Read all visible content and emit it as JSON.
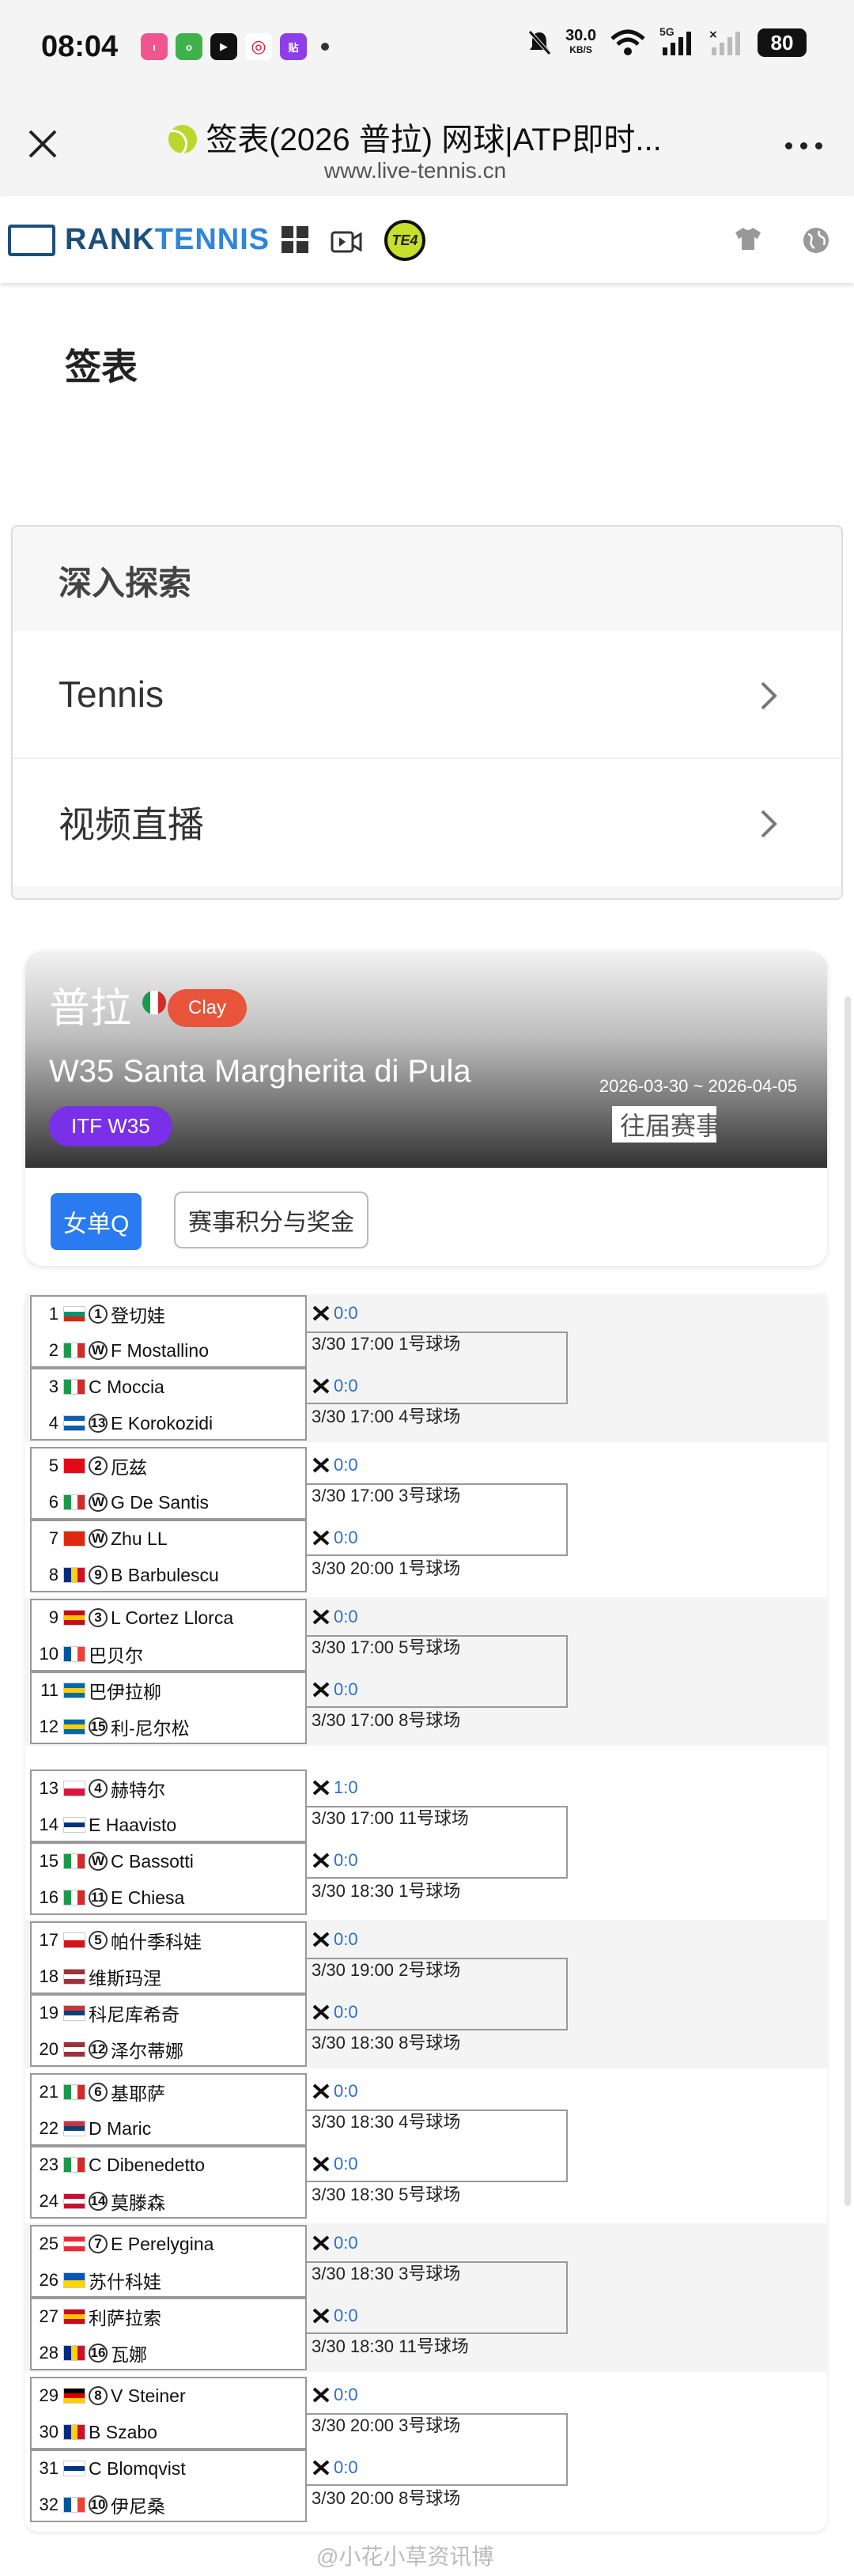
{
  "status_bar": {
    "time": "08:04",
    "app_icons": [
      "bilibili",
      "oppo",
      "video",
      "weibo",
      "tieba"
    ],
    "net_speed": "30.0",
    "net_unit": "KB/S",
    "signal": "5G",
    "battery": "80"
  },
  "browser": {
    "title": "签表(2026 普拉) 网球|ATP即时...",
    "url": "www.live-tennis.cn"
  },
  "site": {
    "logo_part1": "RANK",
    "logo_part2": "TENNIS",
    "live_badge": "TE4"
  },
  "page": {
    "heading": "签表"
  },
  "explore": {
    "heading": "深入探索",
    "items": [
      {
        "label": "Tennis"
      },
      {
        "label": "视频直播"
      }
    ]
  },
  "tournament": {
    "city": "普拉",
    "surface": "Clay",
    "name": "W35 Santa Margherita di Pula",
    "dates": "2026-03-30 ~ 2026-04-05",
    "past_link": "往届赛事",
    "category": "ITF W35",
    "tab_active": "女单Q",
    "tab_points": "赛事积分与奖金"
  },
  "draw": {
    "groups": [
      {
        "players": [
          {
            "num": "1",
            "flag": "bg",
            "seed": "1",
            "name": "登切娃"
          },
          {
            "num": "2",
            "flag": "it",
            "seed": "W",
            "name": "F Mostallino"
          },
          {
            "num": "3",
            "flag": "it",
            "seed": "",
            "name": "C Moccia"
          },
          {
            "num": "4",
            "flag": "gr",
            "seed": "13",
            "name": "E Korokozidi"
          }
        ],
        "matches": [
          {
            "score": "0:0",
            "time": "3/30 17:00 1号球场"
          },
          {
            "score": "0:0",
            "time": "3/30 17:00 4号球场"
          }
        ]
      },
      {
        "players": [
          {
            "num": "5",
            "flag": "tr",
            "seed": "2",
            "name": "厄兹"
          },
          {
            "num": "6",
            "flag": "it",
            "seed": "W",
            "name": "G De Santis"
          },
          {
            "num": "7",
            "flag": "cn",
            "seed": "W",
            "name": "Zhu LL"
          },
          {
            "num": "8",
            "flag": "ro",
            "seed": "9",
            "name": "B Barbulescu"
          }
        ],
        "matches": [
          {
            "score": "0:0",
            "time": "3/30 17:00 3号球场"
          },
          {
            "score": "0:0",
            "time": "3/30 20:00 1号球场"
          }
        ]
      },
      {
        "players": [
          {
            "num": "9",
            "flag": "es",
            "seed": "3",
            "name": "L Cortez Llorca"
          },
          {
            "num": "10",
            "flag": "fr",
            "seed": "",
            "name": "巴贝尔"
          },
          {
            "num": "11",
            "flag": "se",
            "seed": "",
            "name": "巴伊拉柳"
          },
          {
            "num": "12",
            "flag": "se",
            "seed": "15",
            "name": "利-尼尔松"
          }
        ],
        "matches": [
          {
            "score": "0:0",
            "time": "3/30 17:00 5号球场"
          },
          {
            "score": "0:0",
            "time": "3/30 17:00 8号球场"
          }
        ]
      },
      {
        "players": [
          {
            "num": "13",
            "flag": "pl",
            "seed": "4",
            "name": "赫特尔"
          },
          {
            "num": "14",
            "flag": "fi",
            "seed": "",
            "name": "E Haavisto"
          },
          {
            "num": "15",
            "flag": "it",
            "seed": "W",
            "name": "C Bassotti"
          },
          {
            "num": "16",
            "flag": "it",
            "seed": "11",
            "name": "E Chiesa"
          }
        ],
        "matches": [
          {
            "score": "1:0",
            "time": "3/30 17:00 11号球场"
          },
          {
            "score": "0:0",
            "time": "3/30 18:30 1号球场"
          }
        ]
      },
      {
        "players": [
          {
            "num": "17",
            "flag": "cz",
            "seed": "5",
            "name": "帕什季科娃"
          },
          {
            "num": "18",
            "flag": "lv",
            "seed": "",
            "name": "维斯玛涅"
          },
          {
            "num": "19",
            "flag": "rs",
            "seed": "",
            "name": "科尼库希奇"
          },
          {
            "num": "20",
            "flag": "lv",
            "seed": "12",
            "name": "泽尔蒂娜"
          }
        ],
        "matches": [
          {
            "score": "0:0",
            "time": "3/30 19:00 2号球场"
          },
          {
            "score": "0:0",
            "time": "3/30 18:30 8号球场"
          }
        ]
      },
      {
        "players": [
          {
            "num": "21",
            "flag": "it",
            "seed": "6",
            "name": "基耶萨"
          },
          {
            "num": "22",
            "flag": "rs",
            "seed": "",
            "name": "D Maric"
          },
          {
            "num": "23",
            "flag": "it",
            "seed": "",
            "name": "C Dibenedetto"
          },
          {
            "num": "24",
            "flag": "dk",
            "seed": "14",
            "name": "莫滕森"
          }
        ],
        "matches": [
          {
            "score": "0:0",
            "time": "3/30 18:30 4号球场"
          },
          {
            "score": "0:0",
            "time": "3/30 18:30 5号球场"
          }
        ]
      },
      {
        "players": [
          {
            "num": "25",
            "flag": "at",
            "seed": "7",
            "name": "E Perelygina"
          },
          {
            "num": "26",
            "flag": "ua",
            "seed": "",
            "name": "苏什科娃"
          },
          {
            "num": "27",
            "flag": "es",
            "seed": "",
            "name": "利萨拉索"
          },
          {
            "num": "28",
            "flag": "ro",
            "seed": "16",
            "name": "瓦娜"
          }
        ],
        "matches": [
          {
            "score": "0:0",
            "time": "3/30 18:30 3号球场"
          },
          {
            "score": "0:0",
            "time": "3/30 18:30 11号球场"
          }
        ]
      },
      {
        "players": [
          {
            "num": "29",
            "flag": "de",
            "seed": "8",
            "name": "V Steiner"
          },
          {
            "num": "30",
            "flag": "ro",
            "seed": "",
            "name": "B Szabo"
          },
          {
            "num": "31",
            "flag": "fi",
            "seed": "",
            "name": "C Blomqvist"
          },
          {
            "num": "32",
            "flag": "fr",
            "seed": "10",
            "name": "伊尼桑"
          }
        ],
        "matches": [
          {
            "score": "0:0",
            "time": "3/30 20:00 3号球场"
          },
          {
            "score": "0:0",
            "time": "3/30 20:00 8号球场"
          }
        ]
      }
    ]
  },
  "watermark": "@小花小草资讯博",
  "colors": {
    "accent_blue": "#2a7bef",
    "clay": "#e8553a",
    "itf_purple": "#7a2fe8",
    "score_blue": "#2a6fd0"
  }
}
